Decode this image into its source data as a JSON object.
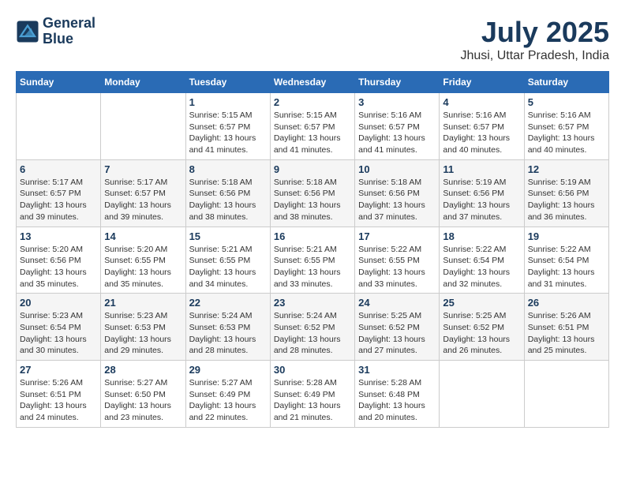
{
  "header": {
    "logo_line1": "General",
    "logo_line2": "Blue",
    "month_title": "July 2025",
    "location": "Jhusi, Uttar Pradesh, India"
  },
  "days_of_week": [
    "Sunday",
    "Monday",
    "Tuesday",
    "Wednesday",
    "Thursday",
    "Friday",
    "Saturday"
  ],
  "weeks": [
    [
      {
        "day": "",
        "info": ""
      },
      {
        "day": "",
        "info": ""
      },
      {
        "day": "1",
        "info": "Sunrise: 5:15 AM\nSunset: 6:57 PM\nDaylight: 13 hours\nand 41 minutes."
      },
      {
        "day": "2",
        "info": "Sunrise: 5:15 AM\nSunset: 6:57 PM\nDaylight: 13 hours\nand 41 minutes."
      },
      {
        "day": "3",
        "info": "Sunrise: 5:16 AM\nSunset: 6:57 PM\nDaylight: 13 hours\nand 41 minutes."
      },
      {
        "day": "4",
        "info": "Sunrise: 5:16 AM\nSunset: 6:57 PM\nDaylight: 13 hours\nand 40 minutes."
      },
      {
        "day": "5",
        "info": "Sunrise: 5:16 AM\nSunset: 6:57 PM\nDaylight: 13 hours\nand 40 minutes."
      }
    ],
    [
      {
        "day": "6",
        "info": "Sunrise: 5:17 AM\nSunset: 6:57 PM\nDaylight: 13 hours\nand 39 minutes."
      },
      {
        "day": "7",
        "info": "Sunrise: 5:17 AM\nSunset: 6:57 PM\nDaylight: 13 hours\nand 39 minutes."
      },
      {
        "day": "8",
        "info": "Sunrise: 5:18 AM\nSunset: 6:56 PM\nDaylight: 13 hours\nand 38 minutes."
      },
      {
        "day": "9",
        "info": "Sunrise: 5:18 AM\nSunset: 6:56 PM\nDaylight: 13 hours\nand 38 minutes."
      },
      {
        "day": "10",
        "info": "Sunrise: 5:18 AM\nSunset: 6:56 PM\nDaylight: 13 hours\nand 37 minutes."
      },
      {
        "day": "11",
        "info": "Sunrise: 5:19 AM\nSunset: 6:56 PM\nDaylight: 13 hours\nand 37 minutes."
      },
      {
        "day": "12",
        "info": "Sunrise: 5:19 AM\nSunset: 6:56 PM\nDaylight: 13 hours\nand 36 minutes."
      }
    ],
    [
      {
        "day": "13",
        "info": "Sunrise: 5:20 AM\nSunset: 6:56 PM\nDaylight: 13 hours\nand 35 minutes."
      },
      {
        "day": "14",
        "info": "Sunrise: 5:20 AM\nSunset: 6:55 PM\nDaylight: 13 hours\nand 35 minutes."
      },
      {
        "day": "15",
        "info": "Sunrise: 5:21 AM\nSunset: 6:55 PM\nDaylight: 13 hours\nand 34 minutes."
      },
      {
        "day": "16",
        "info": "Sunrise: 5:21 AM\nSunset: 6:55 PM\nDaylight: 13 hours\nand 33 minutes."
      },
      {
        "day": "17",
        "info": "Sunrise: 5:22 AM\nSunset: 6:55 PM\nDaylight: 13 hours\nand 33 minutes."
      },
      {
        "day": "18",
        "info": "Sunrise: 5:22 AM\nSunset: 6:54 PM\nDaylight: 13 hours\nand 32 minutes."
      },
      {
        "day": "19",
        "info": "Sunrise: 5:22 AM\nSunset: 6:54 PM\nDaylight: 13 hours\nand 31 minutes."
      }
    ],
    [
      {
        "day": "20",
        "info": "Sunrise: 5:23 AM\nSunset: 6:54 PM\nDaylight: 13 hours\nand 30 minutes."
      },
      {
        "day": "21",
        "info": "Sunrise: 5:23 AM\nSunset: 6:53 PM\nDaylight: 13 hours\nand 29 minutes."
      },
      {
        "day": "22",
        "info": "Sunrise: 5:24 AM\nSunset: 6:53 PM\nDaylight: 13 hours\nand 28 minutes."
      },
      {
        "day": "23",
        "info": "Sunrise: 5:24 AM\nSunset: 6:52 PM\nDaylight: 13 hours\nand 28 minutes."
      },
      {
        "day": "24",
        "info": "Sunrise: 5:25 AM\nSunset: 6:52 PM\nDaylight: 13 hours\nand 27 minutes."
      },
      {
        "day": "25",
        "info": "Sunrise: 5:25 AM\nSunset: 6:52 PM\nDaylight: 13 hours\nand 26 minutes."
      },
      {
        "day": "26",
        "info": "Sunrise: 5:26 AM\nSunset: 6:51 PM\nDaylight: 13 hours\nand 25 minutes."
      }
    ],
    [
      {
        "day": "27",
        "info": "Sunrise: 5:26 AM\nSunset: 6:51 PM\nDaylight: 13 hours\nand 24 minutes."
      },
      {
        "day": "28",
        "info": "Sunrise: 5:27 AM\nSunset: 6:50 PM\nDaylight: 13 hours\nand 23 minutes."
      },
      {
        "day": "29",
        "info": "Sunrise: 5:27 AM\nSunset: 6:49 PM\nDaylight: 13 hours\nand 22 minutes."
      },
      {
        "day": "30",
        "info": "Sunrise: 5:28 AM\nSunset: 6:49 PM\nDaylight: 13 hours\nand 21 minutes."
      },
      {
        "day": "31",
        "info": "Sunrise: 5:28 AM\nSunset: 6:48 PM\nDaylight: 13 hours\nand 20 minutes."
      },
      {
        "day": "",
        "info": ""
      },
      {
        "day": "",
        "info": ""
      }
    ]
  ]
}
